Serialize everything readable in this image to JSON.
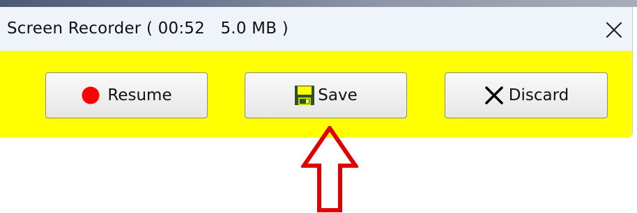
{
  "window": {
    "title": "Screen Recorder ( 00:52   5.0 MB )"
  },
  "buttons": {
    "resume_label": "Resume",
    "save_label": "Save",
    "discard_label": "Discard"
  },
  "icons": {
    "close": "close-icon",
    "record": "record-dot-icon",
    "save": "floppy-disk-icon",
    "discard": "x-icon"
  },
  "colors": {
    "content_background": "#ffff00",
    "titlebar_background": "#eff3fa",
    "record_dot": "#ff0000",
    "floppy_body": "#2f4f2f",
    "annotation_arrow": "#e00000"
  }
}
